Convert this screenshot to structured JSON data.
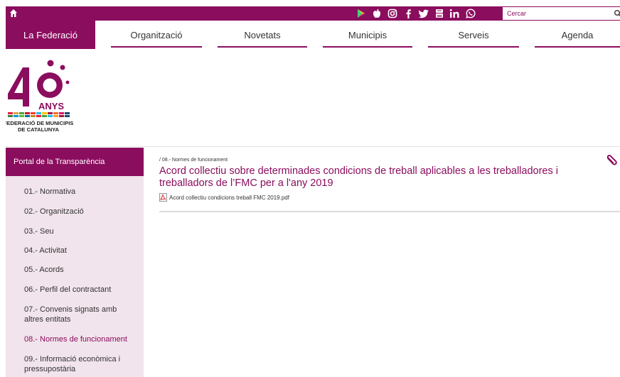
{
  "topbar": {
    "search_placeholder": "Cercar",
    "social_icons": [
      "google-play-icon",
      "apple-icon",
      "instagram-icon",
      "facebook-icon",
      "twitter-icon",
      "youtube-icon",
      "linkedin-icon",
      "whatsapp-icon"
    ]
  },
  "nav": {
    "items": [
      {
        "label": "La Federació"
      },
      {
        "label": "Organització"
      },
      {
        "label": "Novetats"
      },
      {
        "label": "Municipis"
      },
      {
        "label": "Serveis"
      },
      {
        "label": "Agenda"
      }
    ]
  },
  "logo": {
    "anys": "ANYS",
    "line1": "FEDERACIÓ DE MUNICIPIS",
    "line2": "DE CATALUNYA"
  },
  "sidebar": {
    "title": "Portal de la Transparència",
    "items": [
      {
        "label": "01.- Normativa"
      },
      {
        "label": "02.- Organització"
      },
      {
        "label": "03.- Seu"
      },
      {
        "label": "04.- Activitat"
      },
      {
        "label": "05.- Acords"
      },
      {
        "label": "06.- Perfil del contractant"
      },
      {
        "label": "07.- Convenis signats amb altres entitats"
      },
      {
        "label": "08.- Normes de funcionament"
      },
      {
        "label": "09.- Informació econòmica i pressupostària"
      }
    ],
    "active_index": 7
  },
  "main": {
    "breadcrumb": "/ 08.- Normes de funcionament",
    "title": "Acord collectiu sobre determinades condicions de treball aplicables a les treballadores i treballadors de l’FMC per a l'any 2019",
    "attachment": "Acord collectiu condicions treball FMC 2019.pdf"
  },
  "colors": {
    "brand": "#8b0d5e",
    "sidebar_bg": "#f1e4ec"
  }
}
